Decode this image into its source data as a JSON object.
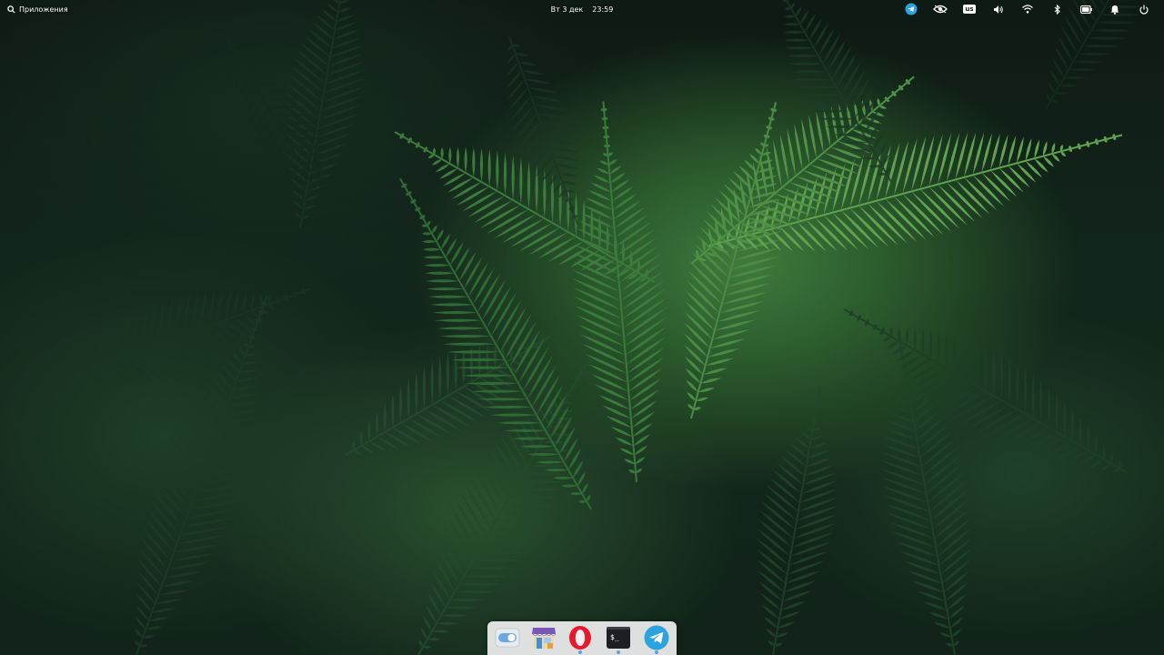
{
  "panel": {
    "applications_label": "Приложения",
    "date": "Вт 3 дек",
    "time": "23:59",
    "keyboard_layout": "us",
    "indicators": [
      "telegram-icon",
      "eye-icon",
      "keyboard-layout",
      "volume-icon",
      "wifi-icon",
      "bluetooth-icon",
      "battery-icon",
      "notification-bell-icon",
      "power-icon"
    ]
  },
  "dock": {
    "apps": [
      {
        "name": "system-settings",
        "icon": "toggle-switch-icon"
      },
      {
        "name": "appcenter",
        "icon": "store-icon"
      },
      {
        "name": "opera",
        "icon": "opera-icon",
        "running": true
      },
      {
        "name": "terminal",
        "icon": "terminal-icon",
        "label": "$_",
        "running": true
      },
      {
        "name": "telegram",
        "icon": "telegram-icon",
        "running": true
      }
    ]
  },
  "colors": {
    "accent_blue": "#2aa3df",
    "opera_red": "#e8192d",
    "dock_bg": "#f0f0f0",
    "wallpaper_dark": "#0e1a14",
    "fern_light": "#5fa34f"
  }
}
